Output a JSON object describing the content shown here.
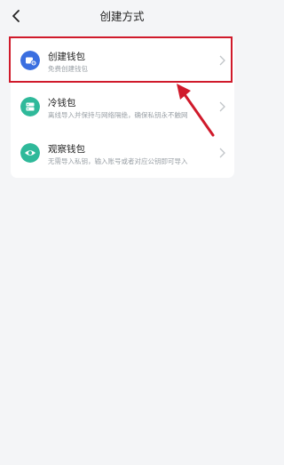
{
  "header": {
    "title": "创建方式"
  },
  "items": [
    {
      "name": "创建钱包",
      "desc": "免费创建钱包"
    },
    {
      "name": "冷钱包",
      "desc": "离线导入并保持与网络隔绝，确保私钥永不触网"
    },
    {
      "name": "观察钱包",
      "desc": "无需导入私钥，输入账号或者对应公钥即可导入"
    }
  ],
  "colors": {
    "blue": "#3b6fe0",
    "green": "#2fb99a",
    "red": "#d01a2b"
  }
}
